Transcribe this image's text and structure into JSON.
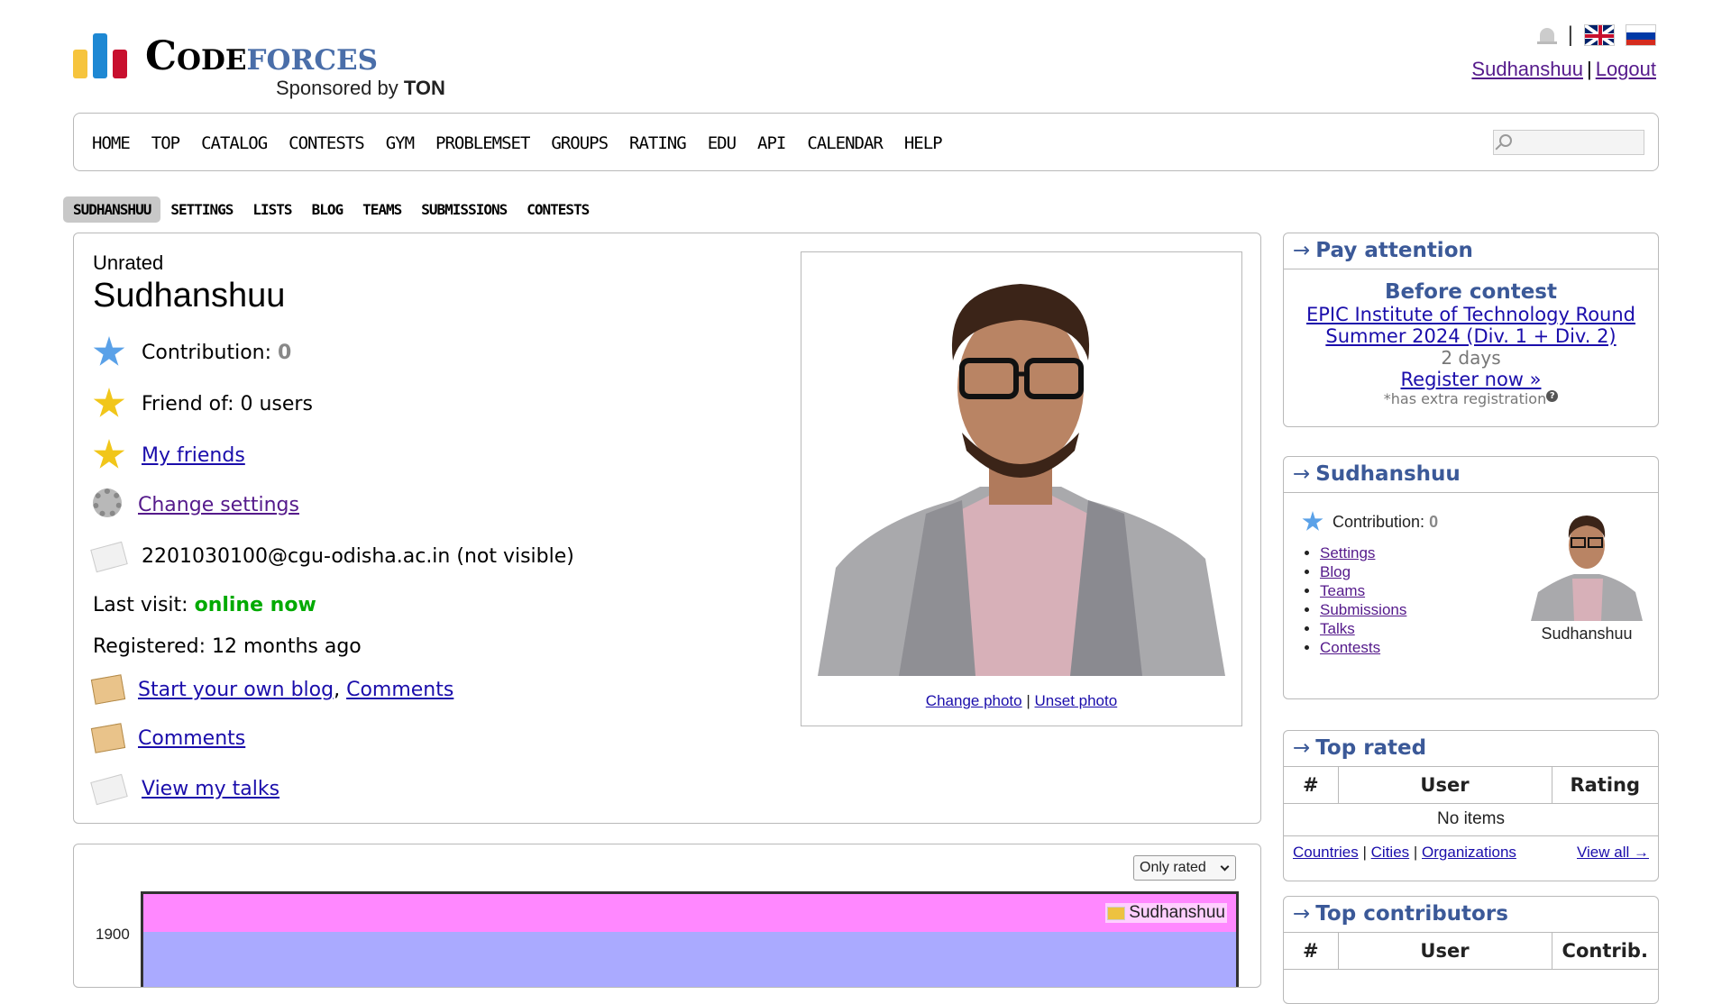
{
  "header": {
    "logo_code": "Code",
    "logo_forces": "forces",
    "sponsor_prefix": "Sponsored by ",
    "sponsor_name": "TON",
    "user_link": "Sudhanshuu",
    "separator": "|",
    "logout": "Logout"
  },
  "main_menu": [
    "HOME",
    "TOP",
    "CATALOG",
    "CONTESTS",
    "GYM",
    "PROBLEMSET",
    "GROUPS",
    "RATING",
    "EDU",
    "API",
    "CALENDAR",
    "HELP"
  ],
  "second_menu": [
    "SUDHANSHUU",
    "SETTINGS",
    "LISTS",
    "BLOG",
    "TEAMS",
    "SUBMISSIONS",
    "CONTESTS"
  ],
  "profile": {
    "rank": "Unrated",
    "handle": "Sudhanshuu",
    "contribution_label": "Contribution:",
    "contribution_value": "0",
    "friend_of": "Friend of: 0 users",
    "my_friends": "My friends",
    "change_settings": "Change settings",
    "email": "2201030100@cgu-odisha.ac.in (not visible)",
    "last_visit_label": "Last visit:",
    "last_visit_value": "online now",
    "registered": "Registered: 12 months ago",
    "start_blog": "Start your own blog",
    "comma": ",",
    "comments": "Comments",
    "comments2": "Comments",
    "view_talks": "View my talks",
    "change_photo": "Change photo",
    "photo_sep": "|",
    "unset_photo": "Unset photo"
  },
  "graph": {
    "select_value": "Only rated",
    "legend": "Sudhanshuu",
    "ytick": "1900",
    "colors": {
      "band_top": "#ff88ff",
      "band_bottom": "#aaaaff",
      "legend": "#edc240"
    }
  },
  "sidebar": {
    "pay_attention": {
      "title": "Pay attention",
      "before": "Before contest",
      "contest_line1": "EPIC Institute of Technology Round",
      "contest_line2": "Summer 2024 (Div. 1 + Div. 2)",
      "days": "2 days",
      "register": "Register now »",
      "extra": "*has extra registration"
    },
    "user_box": {
      "title": "Sudhanshuu",
      "contribution_label": "Contribution:",
      "contribution_value": "0",
      "links": [
        "Settings",
        "Blog",
        "Teams",
        "Submissions",
        "Talks",
        "Contests"
      ],
      "name": "Sudhanshuu"
    },
    "top_rated": {
      "title": "Top rated",
      "headers": [
        "#",
        "User",
        "Rating"
      ],
      "empty": "No items",
      "footer_links": [
        "Countries",
        "Cities",
        "Organizations"
      ],
      "view_all": "View all →"
    },
    "top_contributors": {
      "title": "Top contributors",
      "headers": [
        "#",
        "User",
        "Contrib."
      ]
    },
    "arrow": "→"
  }
}
